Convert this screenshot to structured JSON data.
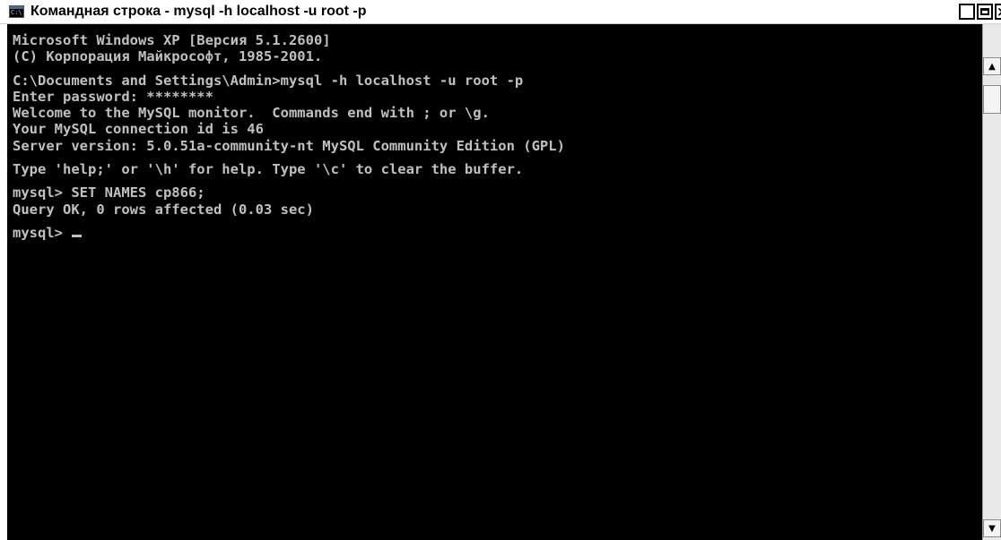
{
  "window": {
    "title": "Командная строка - mysql -h localhost -u root -p",
    "icon_glyph": "C:\\",
    "controls": {
      "minimize": "_",
      "close": "×"
    }
  },
  "console": {
    "lines": [
      "Microsoft Windows XP [Версия 5.1.2600]",
      "(С) Корпорация Майкрософт, 1985-2001.",
      "",
      "C:\\Documents and Settings\\Admin>mysql -h localhost -u root -p",
      "Enter password: ********",
      "Welcome to the MySQL monitor.  Commands end with ; or \\g.",
      "Your MySQL connection id is 46",
      "Server version: 5.0.51a-community-nt MySQL Community Edition (GPL)",
      "",
      "Type 'help;' or '\\h' for help. Type '\\c' to clear the buffer.",
      "",
      "mysql> SET NAMES cp866;",
      "Query OK, 0 rows affected (0.03 sec)",
      "",
      "mysql> "
    ]
  },
  "colors": {
    "console_bg": "#000000",
    "console_fg": "#c0c0c0"
  }
}
